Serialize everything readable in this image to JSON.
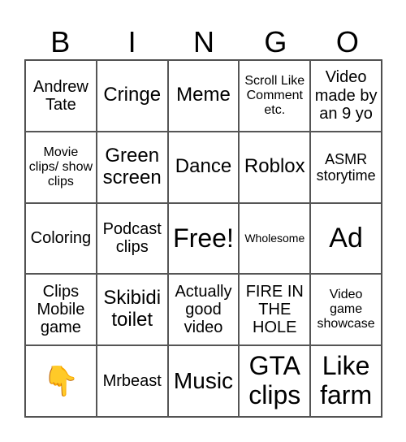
{
  "header": [
    "B",
    "I",
    "N",
    "G",
    "O"
  ],
  "cells": [
    [
      "Andrew Tate",
      "Cringe",
      "Meme",
      "Scroll Like Comment etc.",
      "Video made by an 9 yo"
    ],
    [
      "Movie clips/ show clips",
      "Green screen",
      "Dance",
      "Roblox",
      "ASMR storytime"
    ],
    [
      "Coloring",
      "Podcast clips",
      "Free!",
      "Wholesome",
      "Ad"
    ],
    [
      "Clips Mobile game",
      "Skibidi toilet",
      "Actually good video",
      "FIRE IN THE HOLE",
      "Video game showcase"
    ],
    [
      "👇",
      "Mrbeast",
      "Music",
      "GTA clips",
      "Like farm"
    ]
  ]
}
